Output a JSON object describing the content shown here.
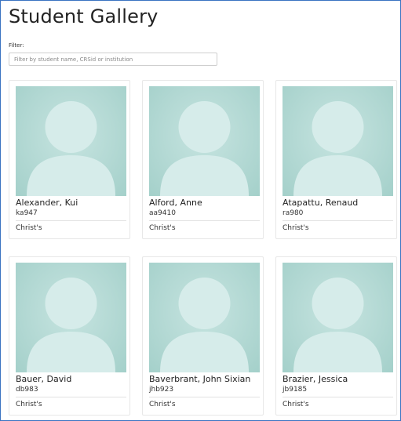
{
  "page": {
    "title": "Student Gallery",
    "filter_label": "Filter:",
    "filter_placeholder": "Filter by student name, CRSid or institution",
    "filter_value": ""
  },
  "students": [
    {
      "name": "Alexander, Kui",
      "crsid": "ka947",
      "college": "Christ's"
    },
    {
      "name": "Alford, Anne",
      "crsid": "aa9410",
      "college": "Christ's"
    },
    {
      "name": "Atapattu, Renaud",
      "crsid": "ra980",
      "college": "Christ's"
    },
    {
      "name": "Bauer, David",
      "crsid": "db983",
      "college": "Christ's"
    },
    {
      "name": "Baverbrant, John Sixian",
      "crsid": "jhb923",
      "college": "Christ's"
    },
    {
      "name": "Brazier, Jessica",
      "crsid": "jb9185",
      "college": "Christ's"
    }
  ],
  "colors": {
    "photo_bg": "#b2d8d3",
    "silhouette": "#d6ecea",
    "frame_border": "#3a73c2"
  },
  "icons": {
    "avatar": "default-avatar-icon"
  }
}
